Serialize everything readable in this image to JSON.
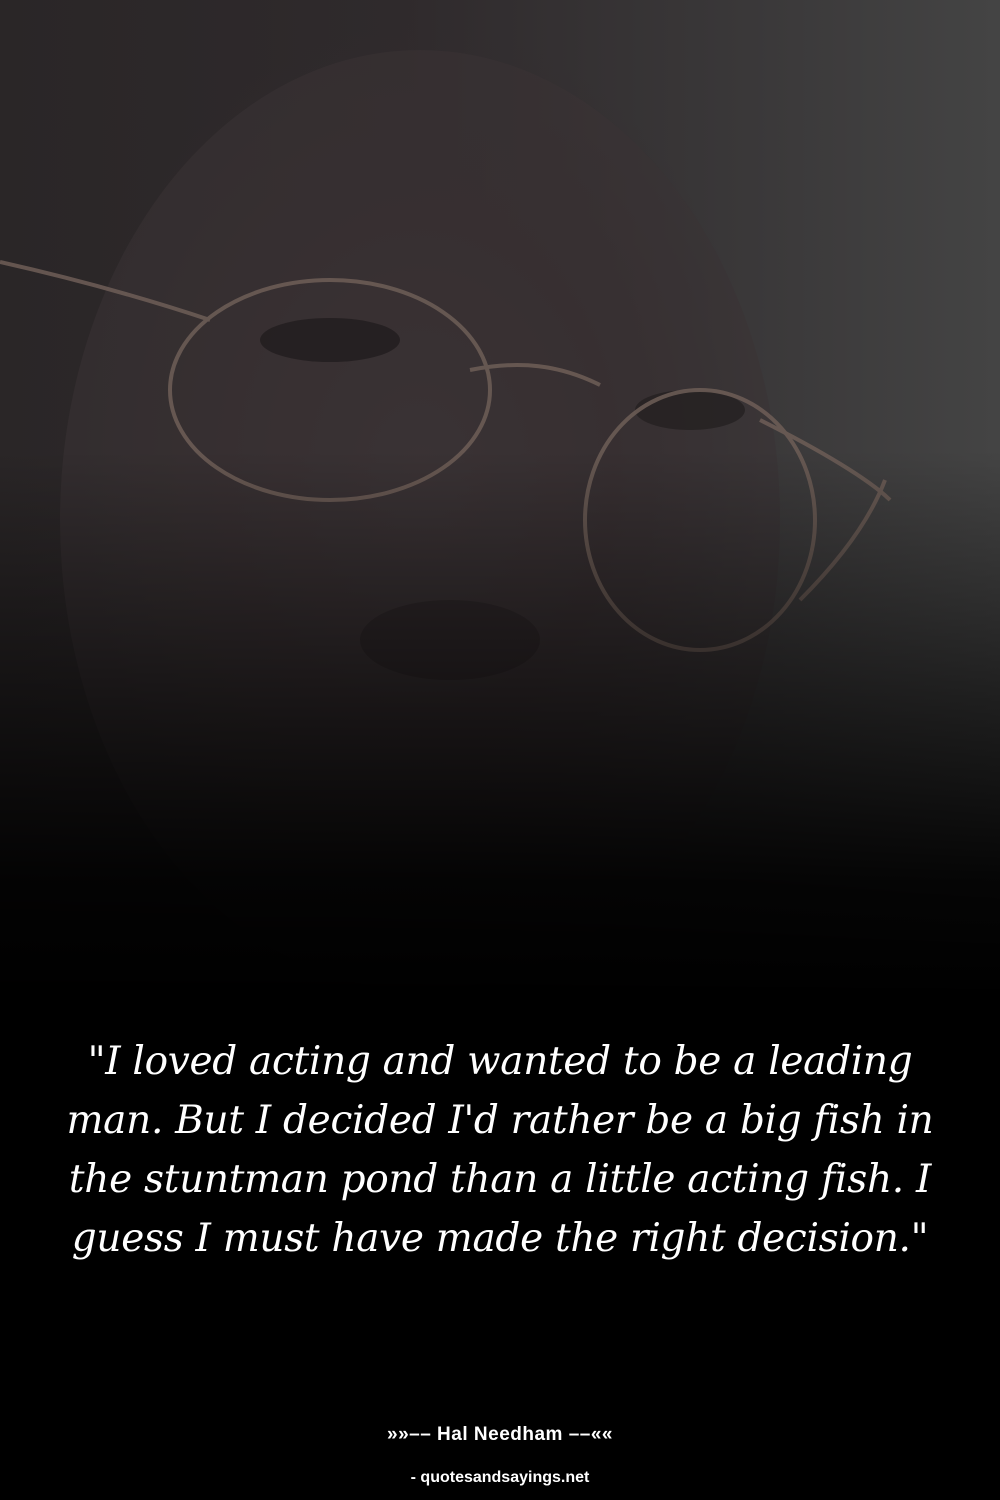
{
  "photo": {
    "subject": "portrait of man with wire-rim glasses",
    "overlay_color": "#000000"
  },
  "quote": {
    "text": "\"I loved acting and wanted to be a leading man. But I decided I'd rather be a big fish in the stuntman pond than a little acting fish. I guess I must have made the right decision.\""
  },
  "author": {
    "line": "»»–– Hal Needham ––««"
  },
  "source": {
    "text": "- quotesandsayings.net"
  },
  "colors": {
    "background": "#000000",
    "text": "#ffffff"
  }
}
